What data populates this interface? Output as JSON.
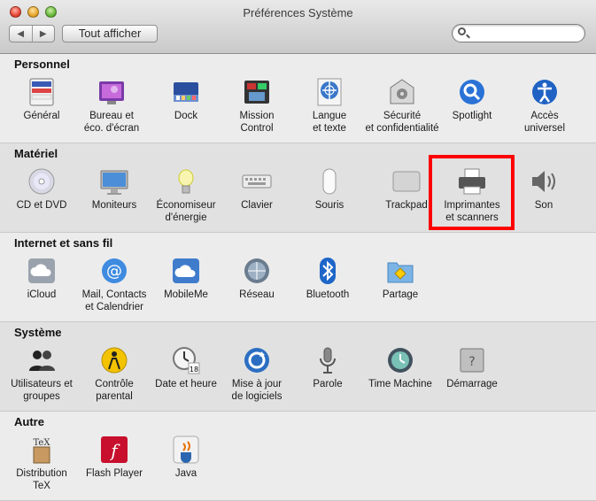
{
  "window": {
    "title": "Préférences Système"
  },
  "toolbar": {
    "back": "◀",
    "forward": "▶",
    "show_all": "Tout afficher",
    "search_value": ""
  },
  "sections": [
    {
      "title": "Personnel",
      "items": [
        {
          "label": "Général",
          "icon": "general-icon"
        },
        {
          "label": "Bureau et\néco. d'écran",
          "icon": "desktop-screensaver-icon"
        },
        {
          "label": "Dock",
          "icon": "dock-icon"
        },
        {
          "label": "Mission\nControl",
          "icon": "mission-control-icon"
        },
        {
          "label": "Langue\net texte",
          "icon": "language-text-icon"
        },
        {
          "label": "Sécurité\net confidentialité",
          "icon": "security-icon"
        },
        {
          "label": "Spotlight",
          "icon": "spotlight-icon"
        },
        {
          "label": "Accès\nuniversel",
          "icon": "universal-access-icon"
        }
      ]
    },
    {
      "title": "Matériel",
      "items": [
        {
          "label": "CD et DVD",
          "icon": "cd-dvd-icon"
        },
        {
          "label": "Moniteurs",
          "icon": "displays-icon"
        },
        {
          "label": "Économiseur\nd'énergie",
          "icon": "energy-saver-icon"
        },
        {
          "label": "Clavier",
          "icon": "keyboard-icon"
        },
        {
          "label": "Souris",
          "icon": "mouse-icon"
        },
        {
          "label": "Trackpad",
          "icon": "trackpad-icon"
        },
        {
          "label": "Imprimantes\net scanners",
          "icon": "printer-icon"
        },
        {
          "label": "Son",
          "icon": "sound-icon"
        }
      ]
    },
    {
      "title": "Internet et sans fil",
      "items": [
        {
          "label": "iCloud",
          "icon": "icloud-icon"
        },
        {
          "label": "Mail, Contacts\net Calendrier",
          "icon": "mail-contacts-icon"
        },
        {
          "label": "MobileMe",
          "icon": "mobileme-icon"
        },
        {
          "label": "Réseau",
          "icon": "network-icon"
        },
        {
          "label": "Bluetooth",
          "icon": "bluetooth-icon"
        },
        {
          "label": "Partage",
          "icon": "sharing-icon"
        }
      ]
    },
    {
      "title": "Système",
      "items": [
        {
          "label": "Utilisateurs et\ngroupes",
          "icon": "users-groups-icon"
        },
        {
          "label": "Contrôle\nparental",
          "icon": "parental-controls-icon"
        },
        {
          "label": "Date et heure",
          "icon": "date-time-icon"
        },
        {
          "label": "Mise à jour\nde logiciels",
          "icon": "software-update-icon"
        },
        {
          "label": "Parole",
          "icon": "speech-icon"
        },
        {
          "label": "Time Machine",
          "icon": "time-machine-icon"
        },
        {
          "label": "Démarrage",
          "icon": "startup-disk-icon"
        }
      ]
    },
    {
      "title": "Autre",
      "items": [
        {
          "label": "Distribution\nTeX",
          "icon": "tex-distribution-icon"
        },
        {
          "label": "Flash Player",
          "icon": "flash-player-icon"
        },
        {
          "label": "Java",
          "icon": "java-icon"
        }
      ]
    }
  ],
  "colors": {
    "highlight": "#ff0000"
  }
}
